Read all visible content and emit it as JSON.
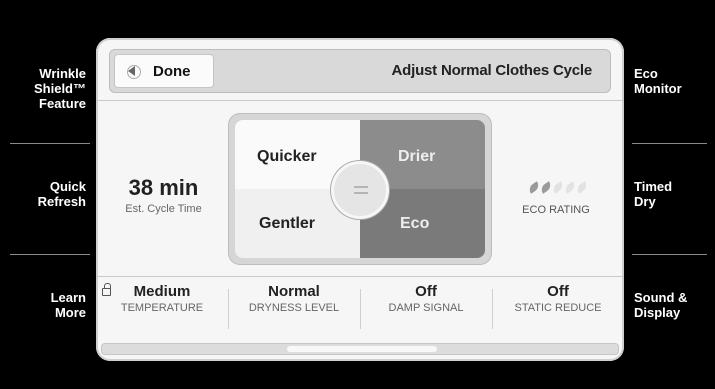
{
  "side_buttons": {
    "left": [
      {
        "label": "Wrinkle\nShield™\nFeature"
      },
      {
        "label": "Quick\nRefresh"
      },
      {
        "label": "Learn\nMore"
      }
    ],
    "right": [
      {
        "label": "Eco\nMonitor"
      },
      {
        "label": "Timed\nDry"
      },
      {
        "label": "Sound &\nDisplay"
      }
    ]
  },
  "header": {
    "done_label": "Done",
    "title": "Adjust Normal Clothes Cycle"
  },
  "cycle_time": {
    "value": "38 min",
    "label": "Est. Cycle Time"
  },
  "eco": {
    "label": "ECO RATING",
    "leaves_filled": 2,
    "leaves_total": 5
  },
  "quadrants": {
    "top_left": "Quicker",
    "top_right": "Drier",
    "bottom_left": "Gentler",
    "bottom_right": "Eco"
  },
  "settings": [
    {
      "value": "Medium",
      "label": "TEMPERATURE"
    },
    {
      "value": "Normal",
      "label": "DRYNESS LEVEL"
    },
    {
      "value": "Off",
      "label": "DAMP SIGNAL"
    },
    {
      "value": "Off",
      "label": "STATIC REDUCE"
    }
  ],
  "icons": {
    "done": "back-arrow-icon",
    "lock": "lock-icon",
    "eco": "leaf-icon",
    "knob": "selector-knob-icon"
  }
}
